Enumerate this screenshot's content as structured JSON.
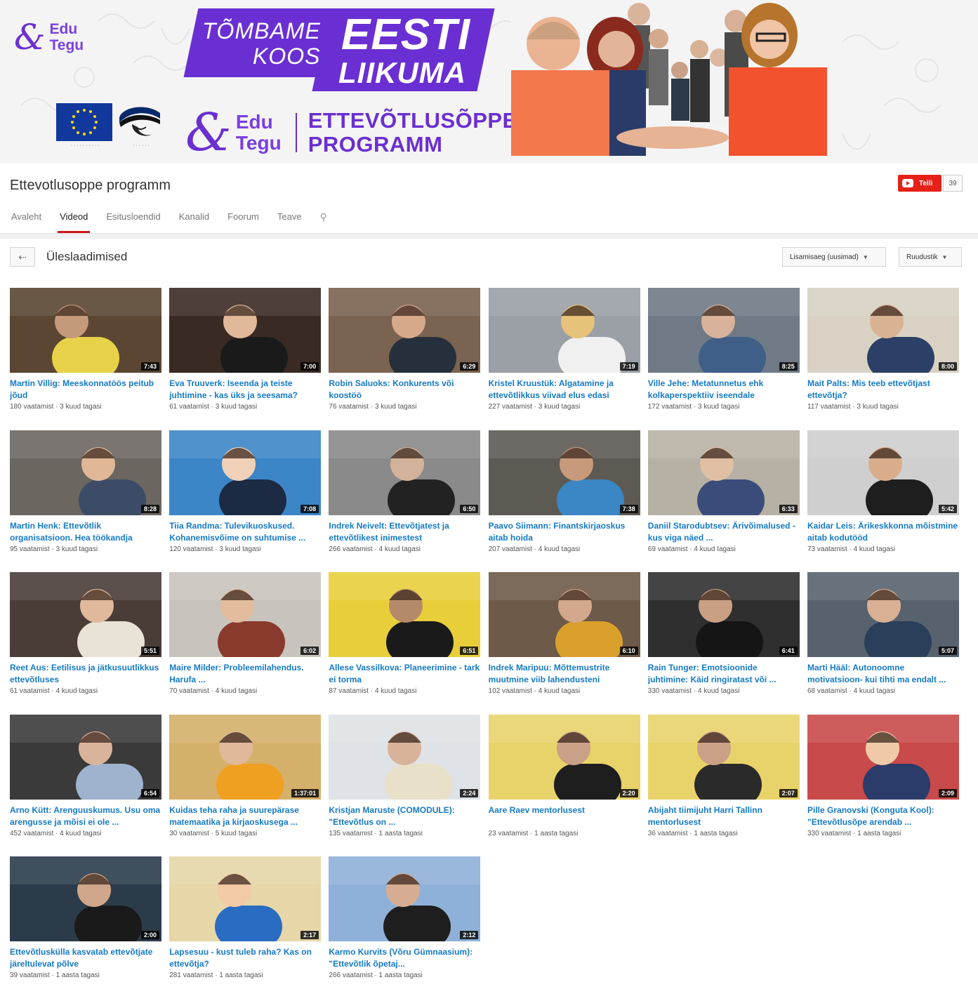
{
  "banner": {
    "logo_small_line1": "Edu",
    "logo_small_line2": "Tegu",
    "slogan_line1": "TÕMBAME",
    "slogan_line2": "KOOS",
    "slogan_line3": "EESTI",
    "slogan_line4": "LIIKUMA",
    "logo_big_line1": "Edu",
    "logo_big_line2": "Tegu",
    "program_line1": "ETTEVÕTLUSÕPPE",
    "program_line2": "PROGRAMM",
    "colors": {
      "purple": "#6a2fd3",
      "eu_blue": "#13389d"
    }
  },
  "channel": {
    "title": "Ettevotlusoppe programm",
    "subscribe_label": "Telli",
    "subscriber_count": "39",
    "tabs": [
      "Avaleht",
      "Videod",
      "Esitusloendid",
      "Kanalid",
      "Foorum",
      "Teave"
    ],
    "active_tab": "Videod",
    "accent": "#cc181e"
  },
  "uploads": {
    "title": "Üleslaadimised",
    "sort_label": "Lisamisaeg (uusimad)",
    "view_label": "Ruudustik"
  },
  "videos": [
    {
      "title": "Martin Villig: Meeskonnatöös peitub jõud",
      "meta": "180 vaatamist · 3 kuud tagasi",
      "duration": "7:43"
    },
    {
      "title": "Eva Truuverk: Iseenda ja teiste juhtimine - kas üks ja seesama?",
      "meta": "61 vaatamist · 3 kuud tagasi",
      "duration": "7:00"
    },
    {
      "title": "Robin Saluoks: Konkurents või koostöö",
      "meta": "76 vaatamist · 3 kuud tagasi",
      "duration": "6:29"
    },
    {
      "title": "Kristel Kruustük: Algatamine ja ettevõtlikkus viivad elus edasi",
      "meta": "227 vaatamist · 3 kuud tagasi",
      "duration": "7:19"
    },
    {
      "title": "Ville Jehe: Metatunnetus ehk kolkaperspektiiv iseendale",
      "meta": "172 vaatamist · 3 kuud tagasi",
      "duration": "8:25"
    },
    {
      "title": "Mait Palts: Mis teeb ettevõtjast ettevõtja?",
      "meta": "117 vaatamist · 3 kuud tagasi",
      "duration": "8:00"
    },
    {
      "title": "Martin Henk: Ettevõtlik organisatsioon. Hea töökandja",
      "meta": "95 vaatamist · 3 kuud tagasi",
      "duration": "8:28"
    },
    {
      "title": "Tiia Randma: Tulevikuoskused. Kohanemisvõime on suhtumise ...",
      "meta": "120 vaatamist · 3 kuud tagasi",
      "duration": "7:08"
    },
    {
      "title": "Indrek Neivelt: Ettevõtjatest ja ettevõtlikest inimestest",
      "meta": "266 vaatamist · 4 kuud tagasi",
      "duration": "6:50"
    },
    {
      "title": "Paavo Siimann: Finantskirjaoskus aitab hoida",
      "meta": "207 vaatamist · 4 kuud tagasi",
      "duration": "7:38"
    },
    {
      "title": "Daniil Starodubtsev: Ärivõimalused - kus viga näed ...",
      "meta": "69 vaatamist · 4 kuud tagasi",
      "duration": "6:33"
    },
    {
      "title": "Kaidar Leis: Ärikeskkonna mõistmine aitab kodutööd",
      "meta": "73 vaatamist · 4 kuud tagasi",
      "duration": "5:42"
    },
    {
      "title": "Reet Aus: Eetilisus ja jätkusuutlikkus ettevõtluses",
      "meta": "61 vaatamist · 4 kuud tagasi",
      "duration": "5:51"
    },
    {
      "title": "Maire Milder: Probleemilahendus. Harufa ...",
      "meta": "70 vaatamist · 4 kuud tagasi",
      "duration": "6:02"
    },
    {
      "title": "Allese Vassilkova: Planeerimine - tark ei torma",
      "meta": "87 vaatamist · 4 kuud tagasi",
      "duration": "6:51"
    },
    {
      "title": "Indrek Maripuu: Mõttemustrite muutmine viib lahendusteni",
      "meta": "102 vaatamist · 4 kuud tagasi",
      "duration": "6:10"
    },
    {
      "title": "Rain Tunger: Emotsioonide juhtimine: Käid ringiratast või ...",
      "meta": "330 vaatamist · 4 kuud tagasi",
      "duration": "6:41"
    },
    {
      "title": "Marti Hääl: Autonoomne motivatsioon- kui tihti ma endalt ...",
      "meta": "68 vaatamist · 4 kuud tagasi",
      "duration": "5:07"
    },
    {
      "title": "Arno Kütt: Arenguuskumus. Usu oma arengusse ja mõisi ei ole ...",
      "meta": "452 vaatamist · 4 kuud tagasi",
      "duration": "6:54"
    },
    {
      "title": "Kuidas teha raha ja suurepärase matemaatika ja kirjaoskusega ...",
      "meta": "30 vaatamist · 5 kuud tagasi",
      "duration": "1:37:01"
    },
    {
      "title": "Kristjan Maruste (COMODULE): \"Ettevõtlus on ...",
      "meta": "135 vaatamist · 1 aasta tagasi",
      "duration": "2:24"
    },
    {
      "title": "Aare Raev mentorlusest",
      "meta": "23 vaatamist · 1 aasta tagasi",
      "duration": "2:20"
    },
    {
      "title": "Abijaht tiimijuht Harri Tallinn mentorlusest",
      "meta": "36 vaatamist · 1 aasta tagasi",
      "duration": "2:07"
    },
    {
      "title": "Pille Granovski (Konguta Kool): \"Ettevõtlusõpe arendab ...",
      "meta": "330 vaatamist · 1 aasta tagasi",
      "duration": "2:09"
    },
    {
      "title": "Ettevõtluskülla kasvatab ettevõtjate järeltulevat põlve",
      "meta": "39 vaatamist · 1 aasta tagasi",
      "duration": "2:00"
    },
    {
      "title": "Lapsesuu - kust tuleb raha? Kas on ettevõtja?",
      "meta": "281 vaatamist · 1 aasta tagasi",
      "duration": "2:17"
    },
    {
      "title": "Karmo Kurvits (Võru Gümnaasium): \"Ettevõtlik õpetaj...",
      "meta": "266 vaatamist · 1 aasta tagasi",
      "duration": "2:12"
    }
  ]
}
